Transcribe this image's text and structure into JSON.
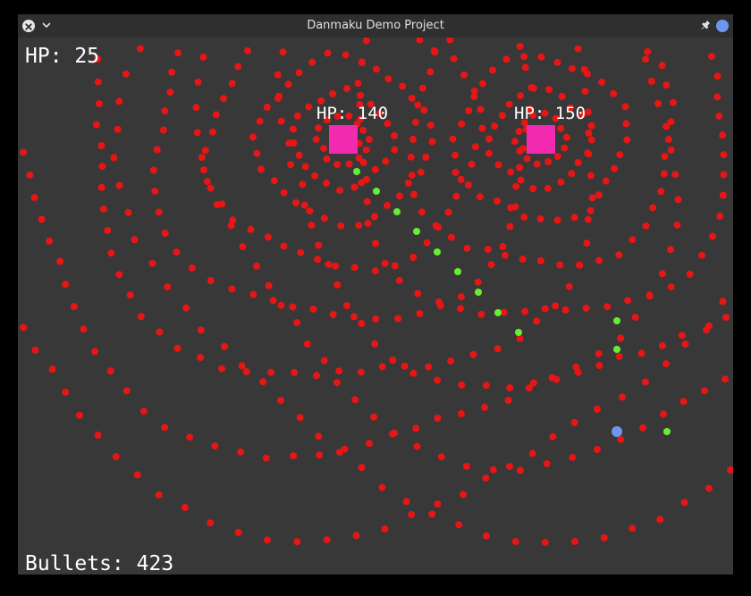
{
  "window": {
    "title": "Danmaku Demo Project",
    "close_icon": "close-icon",
    "menu_icon": "chevron-down-icon",
    "pin_icon": "pin-icon",
    "accent": "#6d97ee"
  },
  "hud": {
    "player_hp": "HP: 25",
    "bullet_count": "Bullets: 423"
  },
  "bosses": [
    {
      "hp_label": "HP: 140",
      "color": "#f22ab0"
    },
    {
      "hp_label": "HP: 150",
      "color": "#f22ab0"
    }
  ],
  "colors": {
    "background": "#383838",
    "enemy_bullet": "#e81515",
    "player_bullet": "#66ee33",
    "player": "#6d97ee"
  }
}
